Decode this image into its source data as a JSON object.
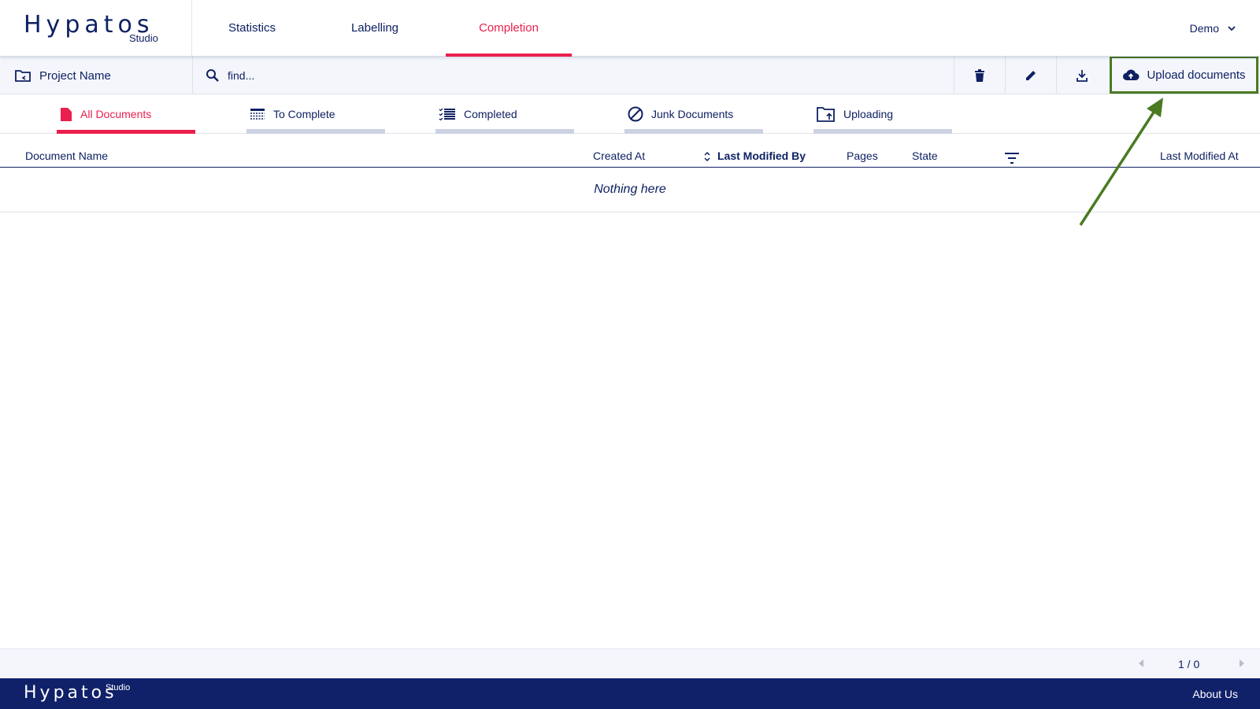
{
  "brand": {
    "name": "Hypatos",
    "sub": "Studio"
  },
  "nav": {
    "tabs": [
      {
        "label": "Statistics"
      },
      {
        "label": "Labelling"
      },
      {
        "label": "Completion"
      }
    ],
    "active_tab": "Completion",
    "user": "Demo"
  },
  "toolbar": {
    "project_name": "Project Name",
    "search_placeholder": "find...",
    "upload_label": "Upload documents",
    "icons": [
      "folder-icon",
      "search-icon",
      "trash-icon",
      "pencil-icon",
      "download-icon",
      "cloud-upload-icon"
    ]
  },
  "doc_tabs": [
    {
      "label": "All Documents",
      "icon": "document-icon"
    },
    {
      "label": "To Complete",
      "icon": "table-icon"
    },
    {
      "label": "Completed",
      "icon": "checklist-icon"
    },
    {
      "label": "Junk Documents",
      "icon": "block-icon"
    },
    {
      "label": "Uploading",
      "icon": "folder-upload-icon"
    }
  ],
  "active_doc_tab": "All Documents",
  "table": {
    "columns": {
      "document_name": "Document Name",
      "created_at": "Created At",
      "last_modified_by": "Last Modified By",
      "pages": "Pages",
      "state": "State",
      "last_modified_at": "Last Modified At"
    },
    "sorted_by": "Last Modified By",
    "empty_message": "Nothing here"
  },
  "pagination": {
    "text": "1 / 0"
  },
  "footer": {
    "brand": "Hypatos",
    "sub": "Studio",
    "link": "About Us"
  },
  "colors": {
    "primary": "#0f2163",
    "accent": "#ea1f4d",
    "highlight": "#4a7a22",
    "toolbar_bg": "#f4f6fb"
  }
}
